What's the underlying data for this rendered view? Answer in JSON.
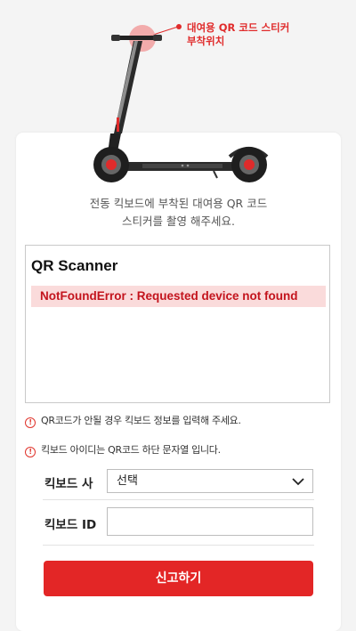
{
  "callout": {
    "line1": "대여용 QR 코드 스티커",
    "line2": "부착위치"
  },
  "instructions": {
    "line1": "전동 킥보드에 부착된 대여용 QR 코드",
    "line2": "스티커를 촬영 해주세요."
  },
  "scanner": {
    "title": "QR Scanner",
    "error": "NotFoundError : Requested device not found"
  },
  "notes": [
    {
      "icon": "info-icon",
      "text": "QR코드가 안될 경우 킥보드 정보를 입력해 주세요."
    },
    {
      "icon": "info-icon",
      "text": "킥보드 아이디는 QR코드 하단 문자열 입니다."
    }
  ],
  "form": {
    "company_label": "킥보드 사",
    "company_value": "선택",
    "id_label": "킥보드 ID",
    "id_value": ""
  },
  "submit_label": "신고하기",
  "colors": {
    "accent": "#e32626",
    "error_bg": "#fadbdb",
    "error_text": "#c3141d"
  }
}
